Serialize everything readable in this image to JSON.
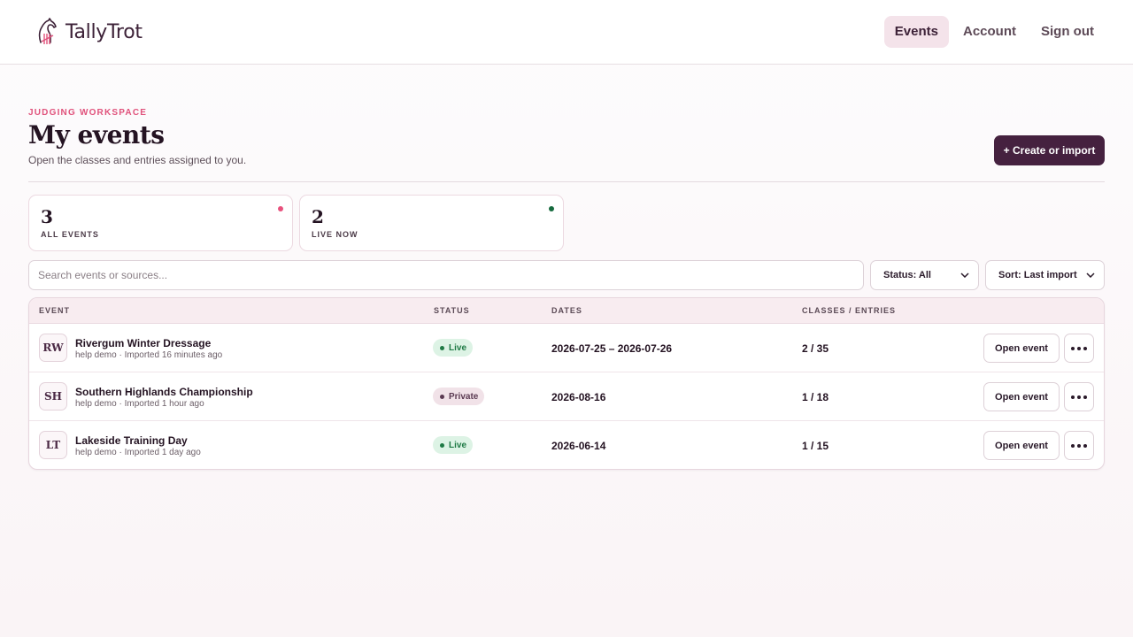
{
  "brand": {
    "name": "TallyTrot",
    "logo_icon": "horse-tally-logo"
  },
  "nav": {
    "items": [
      "Events",
      "Account",
      "Sign out"
    ],
    "active": "Events"
  },
  "header": {
    "eyebrow": "JUDGING WORKSPACE",
    "title": "My events",
    "subtitle": "Open the classes and entries assigned to you.",
    "create_label": "+ Create or import"
  },
  "stats": [
    {
      "value": "3",
      "label": "ALL EVENTS",
      "dot_color": "#e8517d"
    },
    {
      "value": "2",
      "label": "LIVE NOW",
      "dot_color": "#166a3e"
    }
  ],
  "filters": {
    "search_placeholder": "Search events or sources...",
    "status_label": "Status: All",
    "sort_label": "Sort: Last import"
  },
  "table": {
    "columns": [
      "EVENT",
      "STATUS",
      "DATES",
      "CLASSES / ENTRIES"
    ],
    "open_label": "Open event",
    "rows": [
      {
        "initials": "RW",
        "name": "Rivergum Winter Dressage",
        "meta": "help demo · Imported 16 minutes ago",
        "status": "Live",
        "dates": "2026-07-25 – 2026-07-26",
        "counts": "2 / 35"
      },
      {
        "initials": "SH",
        "name": "Southern Highlands Championship",
        "meta": "help demo · Imported 1 hour ago",
        "status": "Private",
        "dates": "2026-08-16",
        "counts": "1 / 18"
      },
      {
        "initials": "LT",
        "name": "Lakeside Training Day",
        "meta": "help demo · Imported 1 day ago",
        "status": "Live",
        "dates": "2026-06-14",
        "counts": "1 / 15"
      }
    ]
  },
  "colors": {
    "accent": "#45213f",
    "eyebrow": "#e0527c",
    "live": "#1f7a45",
    "private": "#5b3a52"
  }
}
